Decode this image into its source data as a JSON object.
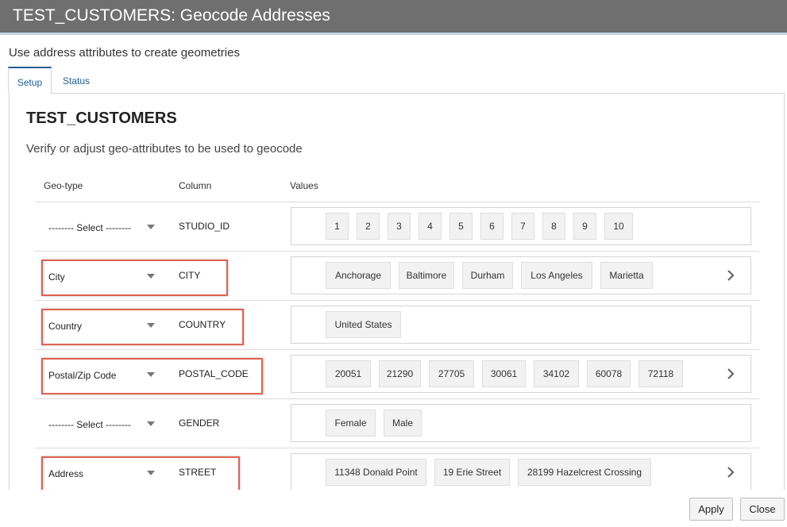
{
  "dialog": {
    "title": "TEST_CUSTOMERS: Geocode Addresses",
    "subtitle": "Use address attributes to create geometries"
  },
  "tabs": [
    {
      "label": "Setup",
      "active": true
    },
    {
      "label": "Status",
      "active": false
    }
  ],
  "panel": {
    "title": "TEST_CUSTOMERS",
    "description": "Verify or adjust geo-attributes to be used to geocode"
  },
  "table": {
    "headers": {
      "geo_type": "Geo-type",
      "column": "Column",
      "values": "Values"
    },
    "rows": [
      {
        "geo_type": "-------- Select --------",
        "column": "STUDIO_ID",
        "values": [
          "1",
          "2",
          "3",
          "4",
          "5",
          "6",
          "7",
          "8",
          "9",
          "10"
        ],
        "has_more": false,
        "highlighted": false
      },
      {
        "geo_type": "City",
        "column": "CITY",
        "values": [
          "Anchorage",
          "Baltimore",
          "Durham",
          "Los Angeles",
          "Marietta"
        ],
        "has_more": true,
        "highlighted": true
      },
      {
        "geo_type": "Country",
        "column": "COUNTRY",
        "values": [
          "United States"
        ],
        "has_more": false,
        "highlighted": true
      },
      {
        "geo_type": "Postal/Zip Code",
        "column": "POSTAL_CODE",
        "values": [
          "20051",
          "21290",
          "27705",
          "30061",
          "34102",
          "60078",
          "72118"
        ],
        "has_more": true,
        "highlighted": true
      },
      {
        "geo_type": "-------- Select --------",
        "column": "GENDER",
        "values": [
          "Female",
          "Male"
        ],
        "has_more": false,
        "highlighted": false
      },
      {
        "geo_type": "Address",
        "column": "STREET",
        "values": [
          "11348 Donald Point",
          "19 Erie Street",
          "28199 Hazelcrest Crossing"
        ],
        "has_more": true,
        "highlighted": true
      }
    ]
  },
  "buttons": {
    "apply": "Apply",
    "close": "Close"
  },
  "colors": {
    "highlight": "#e06050",
    "titlebar": "#6f6f6f",
    "link": "#1f5d95"
  }
}
